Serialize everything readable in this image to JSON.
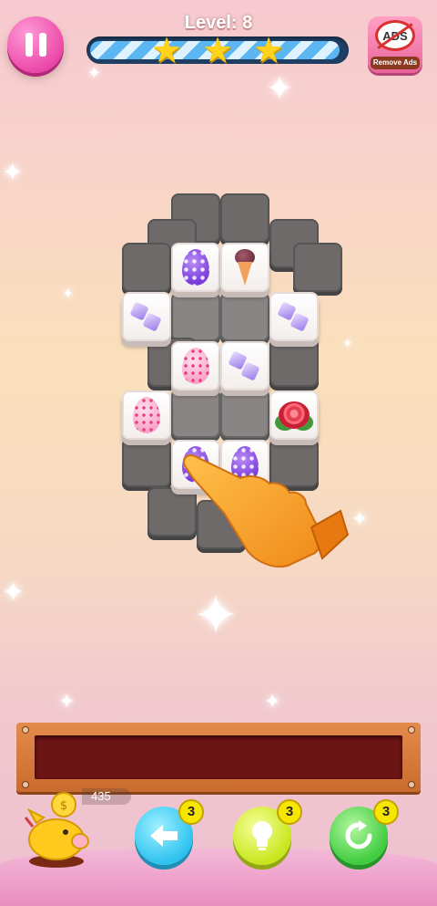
{
  "header": {
    "level_label": "Level: 8",
    "progress_fraction": 0.98,
    "stars": [
      "star-icon",
      "star-icon",
      "star-icon"
    ],
    "remove_ads": {
      "icon_text": "ADS",
      "label": "Remove Ads"
    }
  },
  "board": {
    "open_tiles": [
      {
        "name": "purple-dotted-egg-tile",
        "icon": "purple-dotted-egg"
      },
      {
        "name": "ice-cream-cone-tile",
        "icon": "ice-cream-cone"
      },
      {
        "name": "purple-candy-tile",
        "icon": "purple-candy"
      },
      {
        "name": "purple-candy-tile",
        "icon": "purple-candy"
      },
      {
        "name": "pink-hearts-egg-tile",
        "icon": "pink-hearts-egg"
      },
      {
        "name": "purple-candy-tile",
        "icon": "purple-candy"
      },
      {
        "name": "pink-hearts-egg-tile",
        "icon": "pink-hearts-egg"
      },
      {
        "name": "red-rose-tile",
        "icon": "red-rose"
      },
      {
        "name": "purple-dotted-egg-tile",
        "icon": "purple-dotted-egg"
      },
      {
        "name": "purple-dotted-egg-tile",
        "icon": "purple-dotted-egg"
      }
    ]
  },
  "tray": {
    "slots_filled": 0
  },
  "footer": {
    "coins": "435",
    "undo": {
      "icon": "undo-arrow-icon",
      "count": "3"
    },
    "hint": {
      "icon": "lightbulb-icon",
      "count": "3"
    },
    "shuffle": {
      "icon": "shuffle-icon",
      "count": "3"
    }
  },
  "colors": {
    "pause": "#ec4aa9",
    "undo": "#2ec3ef",
    "hint": "#c8e61e",
    "shuffle": "#3fcc3f",
    "tray_inner": "#6a1414"
  }
}
